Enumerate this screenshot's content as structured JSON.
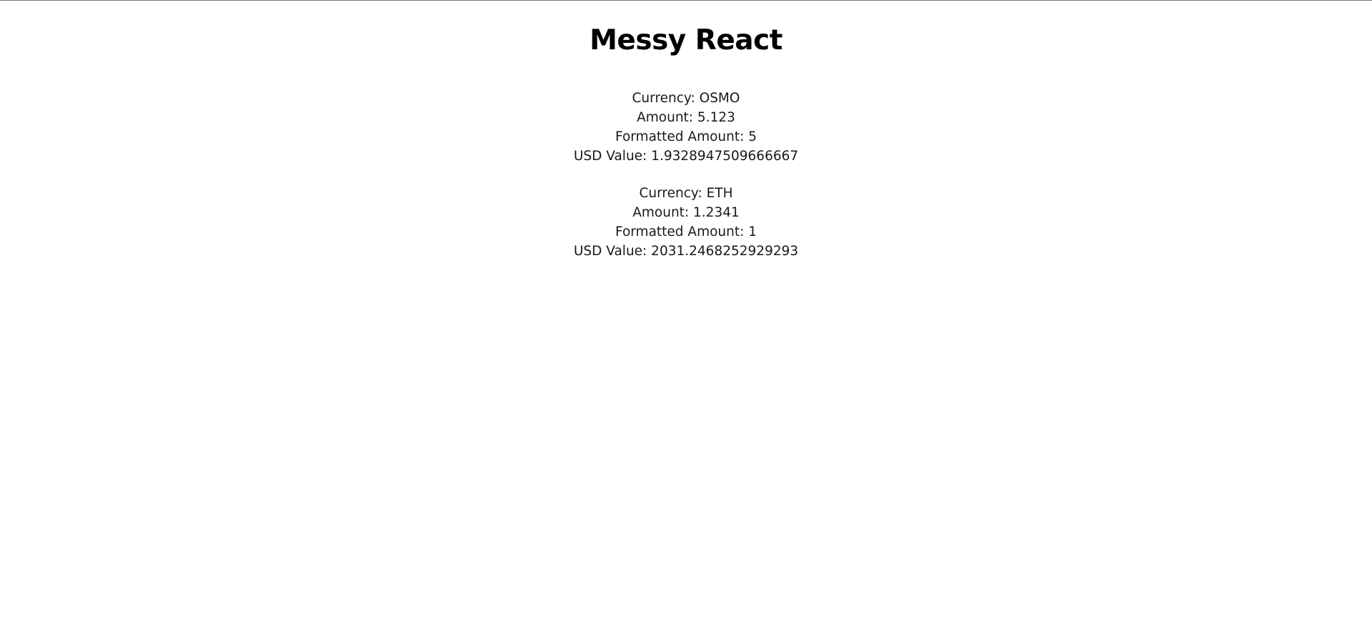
{
  "app": {
    "title": "Messy React"
  },
  "balances": [
    {
      "currency_line": "Currency: OSMO",
      "amount_line": "Amount: 5.123",
      "formatted_line": "Formatted Amount: 5",
      "usd_line": "USD Value: 1.9328947509666667"
    },
    {
      "currency_line": "Currency: ETH",
      "amount_line": "Amount: 1.2341",
      "formatted_line": "Formatted Amount: 1",
      "usd_line": "USD Value: 2031.2468252929293"
    }
  ]
}
